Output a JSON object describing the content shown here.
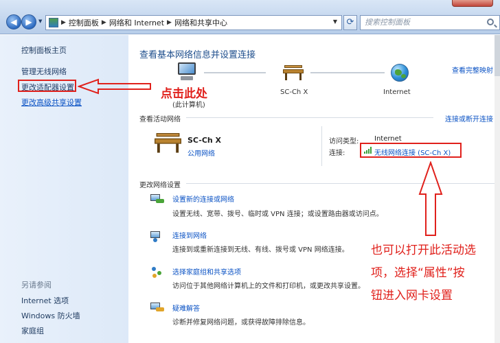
{
  "address_bar": {
    "breadcrumbs": [
      "控制面板",
      "网络和 Internet",
      "网络和共享中心"
    ],
    "search_placeholder": "搜索控制面板"
  },
  "sidebar": {
    "home": "控制面板主页",
    "items": [
      {
        "label": "管理无线网络",
        "link": false
      },
      {
        "label": "更改适配器设置",
        "link": false
      },
      {
        "label": "更改高级共享设置",
        "link": true
      }
    ],
    "see_also_title": "另请参阅",
    "see_also": [
      "Internet 选项",
      "Windows 防火墙",
      "家庭组"
    ]
  },
  "main": {
    "title": "查看基本网络信息并设置连接",
    "full_map_link": "查看完整映射",
    "map": {
      "computer_label_1": "(此计算机)",
      "network_label": "SC-Ch X",
      "internet_label": "Internet"
    },
    "active_networks": {
      "heading": "查看活动网络",
      "connect_link": "连接或断开连接",
      "network_name": "SC-Ch X",
      "network_type": "公用网络",
      "access_type_label": "访问类型:",
      "access_type_value": "Internet",
      "connection_label": "连接:",
      "connection_value": "无线网络连接 (SC-Ch X)"
    },
    "change_settings": {
      "heading": "更改网络设置",
      "tasks": [
        {
          "title": "设置新的连接或网络",
          "desc": "设置无线、宽带、拨号、临时或 VPN 连接；或设置路由器或访问点。"
        },
        {
          "title": "连接到网络",
          "desc": "连接到或重新连接到无线、有线、拨号或 VPN 网络连接。"
        },
        {
          "title": "选择家庭组和共享选项",
          "desc": "访问位于其他网络计算机上的文件和打印机，或更改共享设置。"
        },
        {
          "title": "疑难解答",
          "desc": "诊断并修复网络问题，或获得故障排除信息。"
        }
      ]
    }
  },
  "annotations": {
    "click_here": "点击此处",
    "note_lines": [
      "也可以打开此活动选",
      "项，选择“属性”按",
      "钮进入网卡设置"
    ],
    "color": "#e0201b"
  }
}
